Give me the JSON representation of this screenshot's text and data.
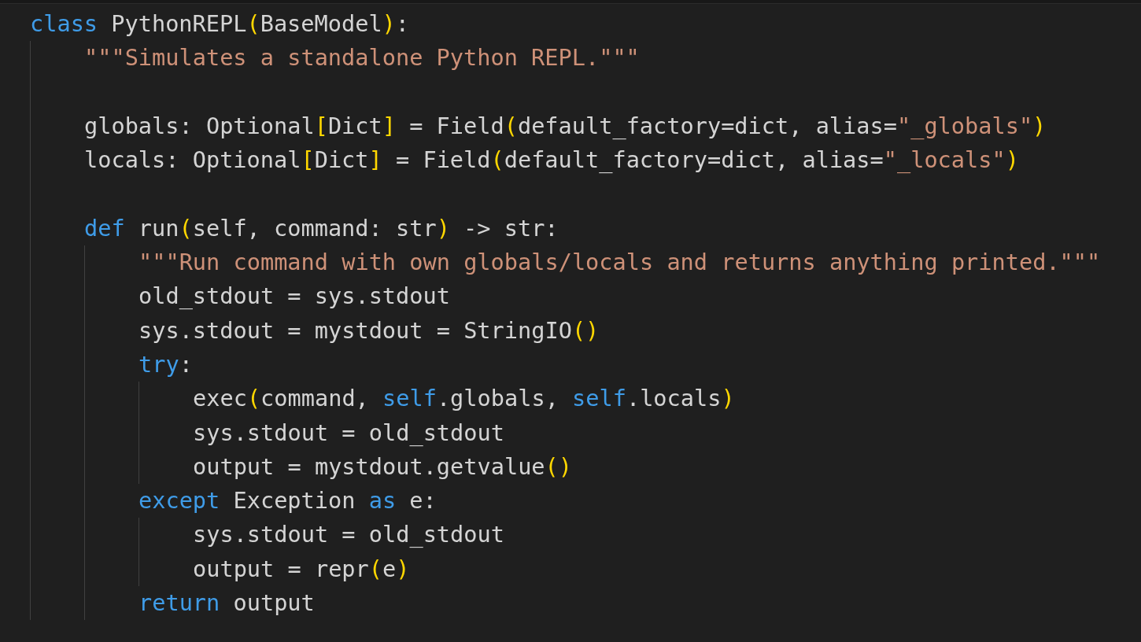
{
  "editor": {
    "lines": [
      {
        "kind": "code",
        "tokens": [
          {
            "t": "class",
            "kind": "keyword"
          },
          {
            "t": " PythonREPL",
            "kind": "plain"
          },
          {
            "t": "(",
            "kind": "bracket"
          },
          {
            "t": "BaseModel",
            "kind": "plain"
          },
          {
            "t": ")",
            "kind": "bracket"
          },
          {
            "t": ":",
            "kind": "plain"
          }
        ],
        "children": [
          {
            "kind": "code",
            "tokens": [
              {
                "t": "\"\"\"Simulates a standalone Python REPL.\"\"\"",
                "kind": "string"
              }
            ]
          },
          {
            "kind": "blank"
          },
          {
            "kind": "code",
            "tokens": [
              {
                "t": "globals: Optional",
                "kind": "plain"
              },
              {
                "t": "[",
                "kind": "bracket"
              },
              {
                "t": "Dict",
                "kind": "plain"
              },
              {
                "t": "]",
                "kind": "bracket"
              },
              {
                "t": " = Field",
                "kind": "plain"
              },
              {
                "t": "(",
                "kind": "bracket"
              },
              {
                "t": "default_factory=dict, alias=",
                "kind": "plain"
              },
              {
                "t": "\"_globals\"",
                "kind": "string"
              },
              {
                "t": ")",
                "kind": "bracket"
              }
            ]
          },
          {
            "kind": "code",
            "tokens": [
              {
                "t": "locals: Optional",
                "kind": "plain"
              },
              {
                "t": "[",
                "kind": "bracket"
              },
              {
                "t": "Dict",
                "kind": "plain"
              },
              {
                "t": "]",
                "kind": "bracket"
              },
              {
                "t": " = Field",
                "kind": "plain"
              },
              {
                "t": "(",
                "kind": "bracket"
              },
              {
                "t": "default_factory=dict, alias=",
                "kind": "plain"
              },
              {
                "t": "\"_locals\"",
                "kind": "string"
              },
              {
                "t": ")",
                "kind": "bracket"
              }
            ]
          },
          {
            "kind": "blank"
          },
          {
            "kind": "code",
            "tokens": [
              {
                "t": "def",
                "kind": "keyword"
              },
              {
                "t": " run",
                "kind": "plain"
              },
              {
                "t": "(",
                "kind": "bracket"
              },
              {
                "t": "self, command: str",
                "kind": "plain"
              },
              {
                "t": ")",
                "kind": "bracket"
              },
              {
                "t": " -> str:",
                "kind": "plain"
              }
            ],
            "children": [
              {
                "kind": "code",
                "tokens": [
                  {
                    "t": "\"\"\"Run command with own globals/locals and returns anything printed.\"\"\"",
                    "kind": "string"
                  }
                ]
              },
              {
                "kind": "code",
                "tokens": [
                  {
                    "t": "old_stdout = sys.stdout",
                    "kind": "plain"
                  }
                ]
              },
              {
                "kind": "code",
                "tokens": [
                  {
                    "t": "sys.stdout = mystdout = StringIO",
                    "kind": "plain"
                  },
                  {
                    "t": "()",
                    "kind": "bracket"
                  }
                ]
              },
              {
                "kind": "code",
                "tokens": [
                  {
                    "t": "try",
                    "kind": "keyword"
                  },
                  {
                    "t": ":",
                    "kind": "plain"
                  }
                ],
                "children": [
                  {
                    "kind": "code",
                    "tokens": [
                      {
                        "t": "exec",
                        "kind": "plain"
                      },
                      {
                        "t": "(",
                        "kind": "bracket"
                      },
                      {
                        "t": "command, ",
                        "kind": "plain"
                      },
                      {
                        "t": "self",
                        "kind": "keyword"
                      },
                      {
                        "t": ".globals, ",
                        "kind": "plain"
                      },
                      {
                        "t": "self",
                        "kind": "keyword"
                      },
                      {
                        "t": ".locals",
                        "kind": "plain"
                      },
                      {
                        "t": ")",
                        "kind": "bracket"
                      }
                    ]
                  },
                  {
                    "kind": "code",
                    "tokens": [
                      {
                        "t": "sys.stdout = old_stdout",
                        "kind": "plain"
                      }
                    ]
                  },
                  {
                    "kind": "code",
                    "tokens": [
                      {
                        "t": "output = mystdout.getvalue",
                        "kind": "plain"
                      },
                      {
                        "t": "()",
                        "kind": "bracket"
                      }
                    ]
                  }
                ]
              },
              {
                "kind": "code",
                "tokens": [
                  {
                    "t": "except",
                    "kind": "keyword"
                  },
                  {
                    "t": " Exception ",
                    "kind": "plain"
                  },
                  {
                    "t": "as",
                    "kind": "keyword"
                  },
                  {
                    "t": " e:",
                    "kind": "plain"
                  }
                ],
                "children": [
                  {
                    "kind": "code",
                    "tokens": [
                      {
                        "t": "sys.stdout = old_stdout",
                        "kind": "plain"
                      }
                    ]
                  },
                  {
                    "kind": "code",
                    "tokens": [
                      {
                        "t": "output = repr",
                        "kind": "plain"
                      },
                      {
                        "t": "(",
                        "kind": "bracket"
                      },
                      {
                        "t": "e",
                        "kind": "plain"
                      },
                      {
                        "t": ")",
                        "kind": "bracket"
                      }
                    ]
                  }
                ]
              },
              {
                "kind": "code",
                "tokens": [
                  {
                    "t": "return",
                    "kind": "keyword"
                  },
                  {
                    "t": " output",
                    "kind": "plain"
                  }
                ]
              }
            ]
          }
        ]
      }
    ]
  }
}
